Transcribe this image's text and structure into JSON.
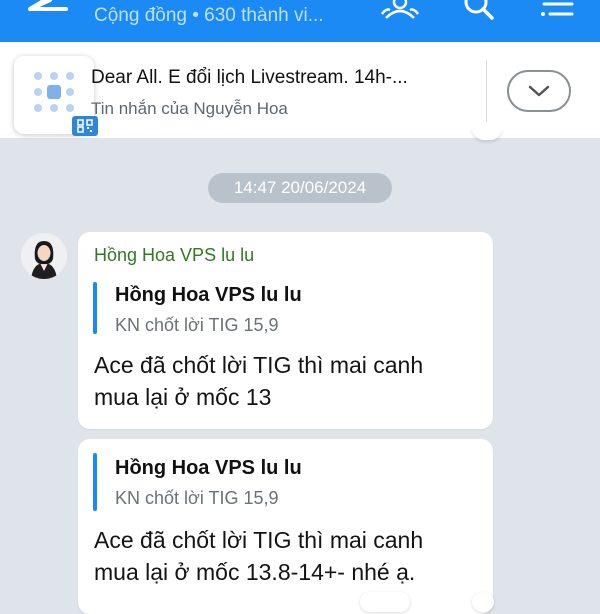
{
  "header": {
    "subtitle": "Cộng đồng • 630 thành vi...",
    "icons": [
      "back-arrow-icon",
      "members-icon",
      "search-icon",
      "menu-icon"
    ]
  },
  "pinned": {
    "title": "Dear All. E đổi lịch Livestream. 14h-...",
    "subtitle": "Tin nhắn của Nguyễn Hoa",
    "icons": [
      "pin-thumbnail-icon",
      "qr-icon",
      "chevron-down-icon"
    ]
  },
  "timestamp": "14:47 20/06/2024",
  "colors": {
    "header": "#1b8af5",
    "sender": "#2f7a1f",
    "chat_background": "#dfe4ea",
    "quote_bar": "#1b8af5"
  },
  "messages": [
    {
      "sender": "Hồng Hoa VPS lu lu",
      "quote_name": "Hồng Hoa VPS lu lu",
      "quote_text": "KN chốt lời TIG 15,9",
      "lines": [
        "Ace đã chốt lời TIG thì mai canh",
        "mua lại ở mốc 13"
      ]
    },
    {
      "quote_name": "Hồng Hoa VPS lu lu",
      "quote_text": "KN chốt lời TIG 15,9",
      "lines": [
        "Ace đã chốt lời TIG thì mai canh",
        "mua lại ở mốc 13.8-14+- nhé ạ."
      ]
    }
  ]
}
